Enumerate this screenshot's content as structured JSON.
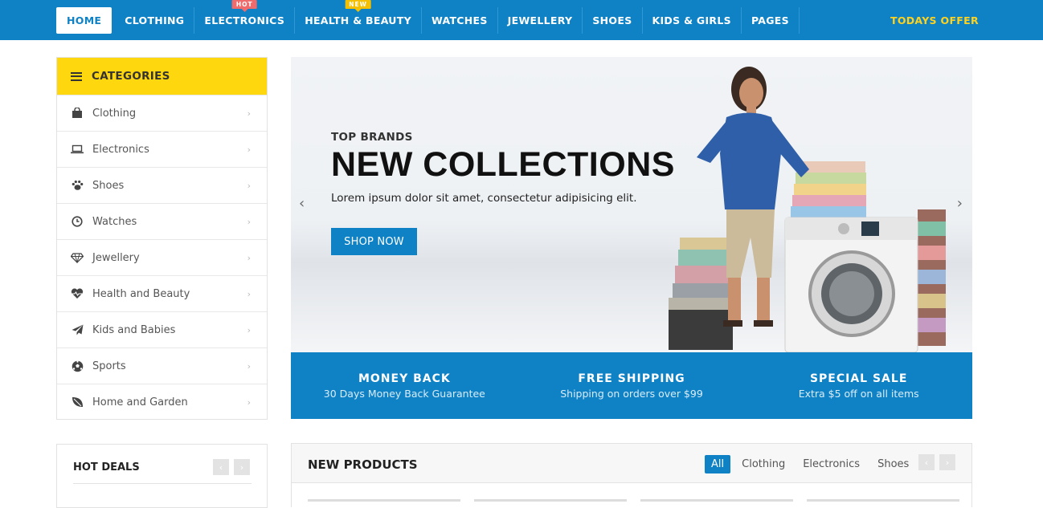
{
  "nav": {
    "items": [
      {
        "label": "HOME",
        "badge": ""
      },
      {
        "label": "CLOTHING",
        "badge": ""
      },
      {
        "label": "ELECTRONICS",
        "badge": "HOT"
      },
      {
        "label": "HEALTH & BEAUTY",
        "badge": "NEW"
      },
      {
        "label": "WATCHES",
        "badge": ""
      },
      {
        "label": "JEWELLERY",
        "badge": ""
      },
      {
        "label": "SHOES",
        "badge": ""
      },
      {
        "label": "KIDS & GIRLS",
        "badge": ""
      },
      {
        "label": "PAGES",
        "badge": ""
      }
    ],
    "todays_offer": "TODAYS OFFER"
  },
  "categories": {
    "title": "CATEGORIES",
    "items": [
      {
        "label": "Clothing",
        "icon": "shopping-bag-icon"
      },
      {
        "label": "Electronics",
        "icon": "laptop-icon"
      },
      {
        "label": "Shoes",
        "icon": "paw-icon"
      },
      {
        "label": "Watches",
        "icon": "clock-icon"
      },
      {
        "label": "Jewellery",
        "icon": "diamond-icon"
      },
      {
        "label": "Health and Beauty",
        "icon": "heartbeat-icon"
      },
      {
        "label": "Kids and Babies",
        "icon": "paper-plane-icon"
      },
      {
        "label": "Sports",
        "icon": "soccer-ball-icon"
      },
      {
        "label": "Home and Garden",
        "icon": "leaf-icon"
      }
    ]
  },
  "slider": {
    "subtitle": "TOP BRANDS",
    "title": "NEW COLLECTIONS",
    "description": "Lorem ipsum dolor sit amet, consectetur adipisicing elit.",
    "button": "SHOP NOW"
  },
  "features": [
    {
      "title": "MONEY BACK",
      "desc": "30 Days Money Back Guarantee"
    },
    {
      "title": "FREE SHIPPING",
      "desc": "Shipping on orders over $99"
    },
    {
      "title": "SPECIAL SALE",
      "desc": "Extra $5 off on all items"
    }
  ],
  "hot_deals": {
    "title": "HOT DEALS"
  },
  "new_products": {
    "title": "NEW PRODUCTS",
    "tabs": [
      "All",
      "Clothing",
      "Electronics",
      "Shoes"
    ]
  },
  "colors": {
    "primary": "#0f82c6",
    "accent_yellow": "#fed70e",
    "offer_yellow": "#ffd21e",
    "hot_badge": "#f06b6b",
    "new_badge": "#f5c000"
  }
}
